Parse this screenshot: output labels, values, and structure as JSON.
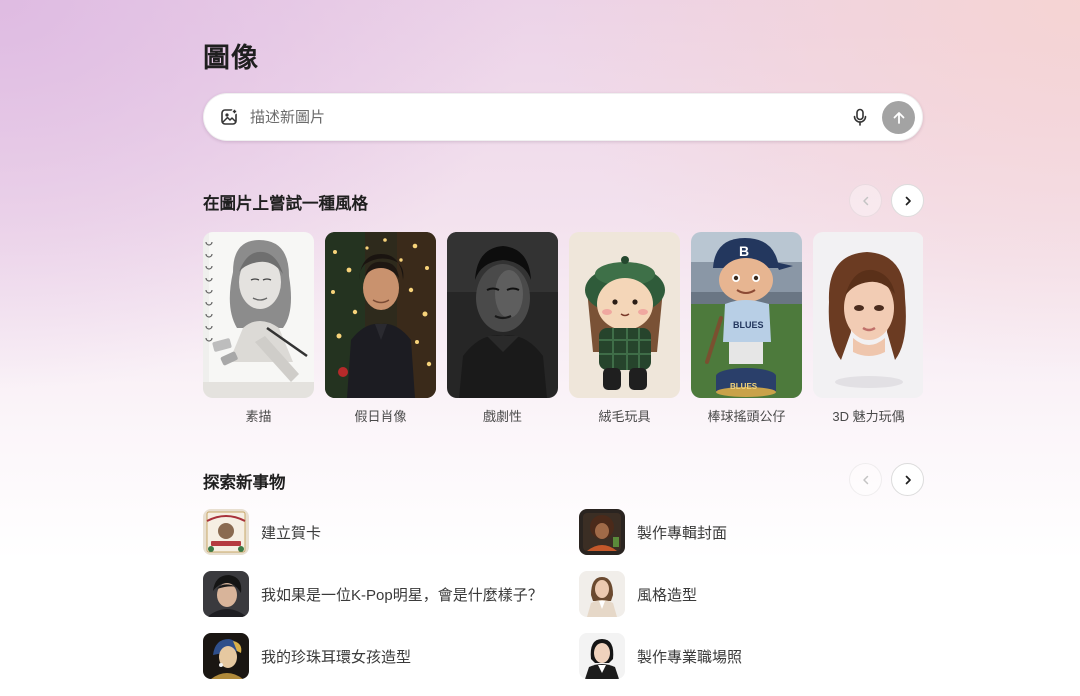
{
  "page": {
    "title": "圖像"
  },
  "prompt": {
    "placeholder": "描述新圖片",
    "value": "",
    "leading_icon": "image-add-icon",
    "mic_icon": "microphone-icon",
    "send_icon": "arrow-up-icon"
  },
  "styles_section": {
    "title": "在圖片上嘗試一種風格",
    "prev_icon": "chevron-left-icon",
    "next_icon": "chevron-right-icon",
    "items": [
      {
        "label": "素描"
      },
      {
        "label": "假日肖像"
      },
      {
        "label": "戲劇性"
      },
      {
        "label": "絨毛玩具"
      },
      {
        "label": "棒球搖頭公仔"
      },
      {
        "label": "3D 魅力玩偶"
      }
    ]
  },
  "explore_section": {
    "title": "探索新事物",
    "prev_icon": "chevron-left-icon",
    "next_icon": "chevron-right-icon",
    "items": [
      {
        "label": "建立賀卡"
      },
      {
        "label": "製作專輯封面"
      },
      {
        "label": "我如果是一位K-Pop明星，會是什麼樣子？"
      },
      {
        "label": "風格造型"
      },
      {
        "label": "我的珍珠耳環女孩造型"
      },
      {
        "label": "製作專業職場照"
      }
    ]
  },
  "colors": {
    "send_button": "#a3a3a3",
    "text_primary": "#1f1f1f",
    "text_secondary": "#4a4a4a"
  }
}
